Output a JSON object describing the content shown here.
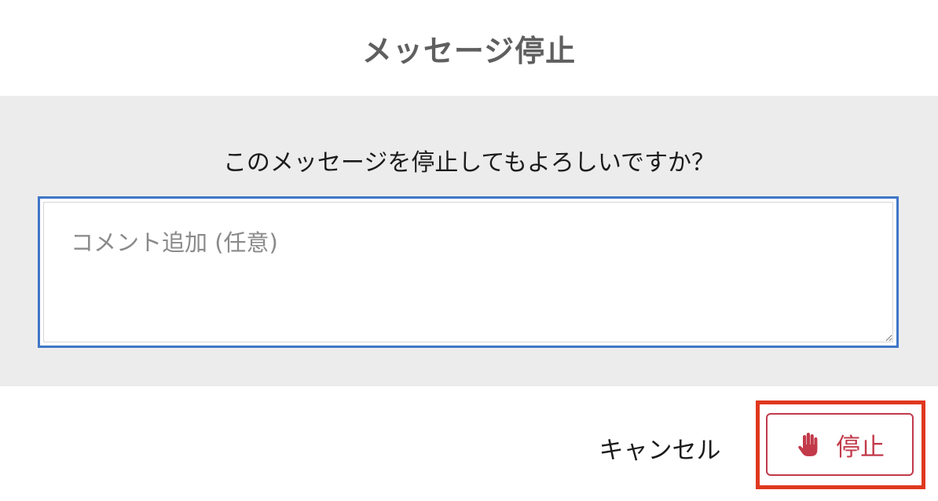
{
  "dialog": {
    "title": "メッセージ停止",
    "question": "このメッセージを停止してもよろしいですか？",
    "comment": {
      "value": "",
      "placeholder": "コメント追加 (任意)"
    },
    "buttons": {
      "cancel_label": "キャンセル",
      "stop_label": "停止",
      "stop_icon": "hand-stop-icon"
    },
    "colors": {
      "accent_red": "#c23a4a",
      "focus_blue": "#3f76c8",
      "highlight": "#e0381f"
    }
  }
}
